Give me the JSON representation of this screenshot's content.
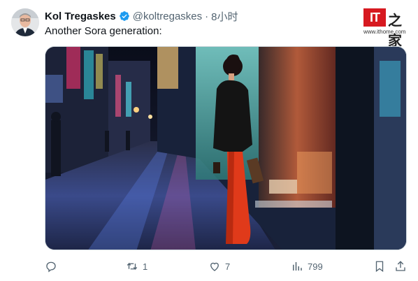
{
  "tweet": {
    "display_name": "Kol Tregaskes",
    "handle": "@koltregaskes",
    "separator": "·",
    "time": "8小时",
    "text": "Another Sora generation:",
    "verified_icon": "verified-badge-icon",
    "verified_color": "#1d9bf0"
  },
  "watermark": {
    "brand": "IT",
    "brand_cn": "之家",
    "url": "www.ithome.com",
    "brand_color": "#d71920"
  },
  "media": {
    "alt": "Woman in red skirt and leather jacket at neon-lit shop window on a rainy night street"
  },
  "actions": {
    "reply_count": "",
    "retweet_count": "1",
    "like_count": "7",
    "views_count": "799",
    "icons": [
      "reply-icon",
      "retweet-icon",
      "like-icon",
      "views-icon",
      "bookmark-icon",
      "share-icon"
    ]
  }
}
